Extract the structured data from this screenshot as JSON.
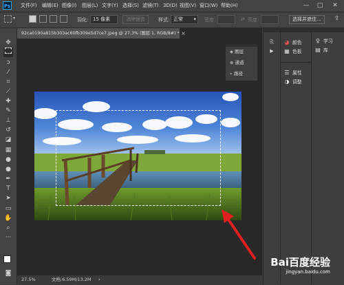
{
  "menubar": {
    "logo": "Ps",
    "items": [
      "文件(F)",
      "编辑(E)",
      "图像(I)",
      "图层(L)",
      "文字(Y)",
      "选择(S)",
      "滤镜(T)",
      "3D(D)",
      "视图(V)",
      "窗口(W)",
      "帮助(H)"
    ],
    "minimize": "—",
    "maximize": "□",
    "close": "✕"
  },
  "options": {
    "feather_label": "羽化:",
    "feather_value": "15 像素",
    "antialias_label": "消除锯齿",
    "style_label": "样式:",
    "style_value": "正常",
    "width_label": "宽度:",
    "height_label": "高度:",
    "select_mask_label": "选择并遮住...",
    "share_icon": "share-icon"
  },
  "document": {
    "tab_title": "92ca0190a815b303ac60fb309e5d7ce7.jpeg @ 27.3% (图层 1, RGB/8#) *",
    "close": "×",
    "zoom": "27.5%",
    "doc_info": "文档:6.59M/13.2M"
  },
  "float_panel": {
    "items": [
      {
        "icon": "layers-icon",
        "label": "图层"
      },
      {
        "icon": "channels-icon",
        "label": "通道"
      },
      {
        "icon": "paths-icon",
        "label": "路径"
      }
    ]
  },
  "right_panel": {
    "col2": [
      {
        "icon": "color-icon",
        "label": "颜色"
      },
      {
        "icon": "swatches-icon",
        "label": "色板"
      },
      {
        "icon": "properties-icon",
        "label": "属性"
      },
      {
        "icon": "adjustments-icon",
        "label": "调整"
      }
    ],
    "col3": [
      {
        "icon": "learn-icon",
        "label": "学习"
      },
      {
        "icon": "libraries-icon",
        "label": "库"
      }
    ]
  },
  "watermark": {
    "logo": "Bai百度经验",
    "url": "jingyan.baidu.com"
  },
  "colors": {
    "accent": "#31a8ff",
    "annotation_arrow": "#e02020"
  }
}
